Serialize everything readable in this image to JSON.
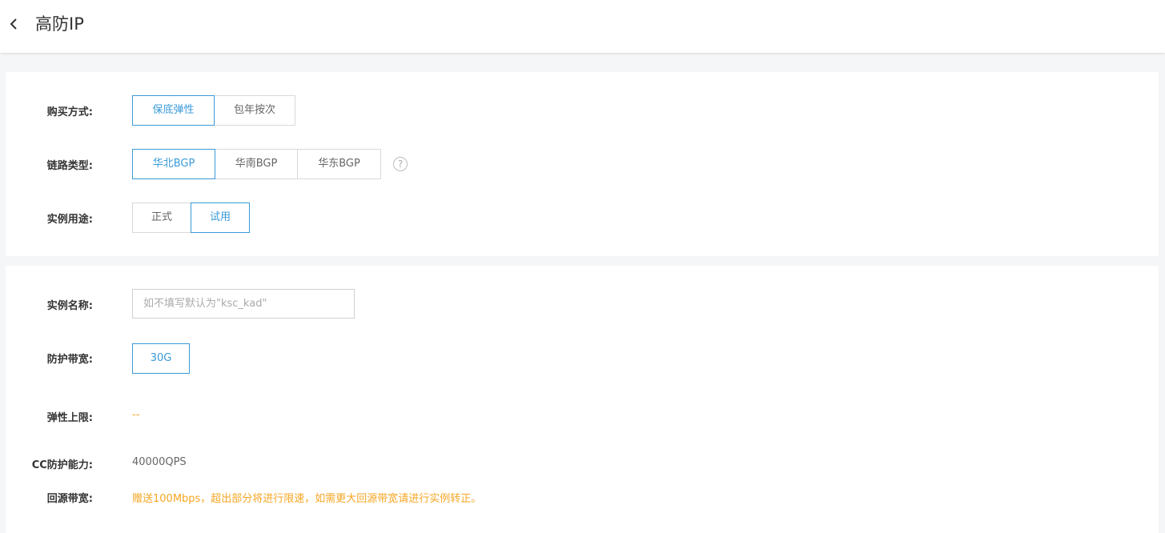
{
  "header": {
    "title": "高防IP",
    "back_icon": "chevron-left-icon"
  },
  "purchase": {
    "label": "购买方式:",
    "options": [
      "保底弹性",
      "包年按次"
    ],
    "selected": "保底弹性"
  },
  "link": {
    "label": "链路类型:",
    "options": [
      "华北BGP",
      "华南BGP",
      "华东BGP"
    ],
    "selected": "华北BGP",
    "help_icon": "question-circle-icon",
    "help_glyph": "?"
  },
  "usage": {
    "label": "实例用途:",
    "options": [
      "正式",
      "试用"
    ],
    "selected": "试用"
  },
  "name": {
    "label": "实例名称:",
    "placeholder": "如不填写默认为\"ksc_kad\"",
    "value": ""
  },
  "bandwidth": {
    "label": "防护带宽:",
    "options": [
      "30G"
    ],
    "selected": "30G"
  },
  "elastic": {
    "label": "弹性上限:",
    "value": "--"
  },
  "cc": {
    "label": "CC防护能力:",
    "value": "40000QPS"
  },
  "backsrc": {
    "label": "回源带宽:",
    "value": "赠送100Mbps，超出部分将进行限速，如需更大回源带宽请进行实例转正。"
  },
  "colors": {
    "accent": "#3a9ad9",
    "warning": "#f5a623",
    "border": "#d9d9d9"
  }
}
